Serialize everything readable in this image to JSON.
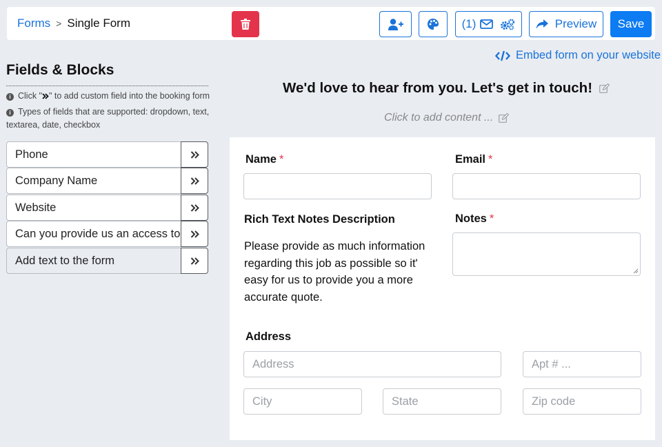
{
  "breadcrumb": {
    "link": "Forms",
    "separator": ">",
    "current": "Single Form"
  },
  "toolbar": {
    "email_count": "(1)",
    "preview_label": "Preview",
    "save_label": "Save"
  },
  "embed_link": "Embed form on your website",
  "sidebar": {
    "title": "Fields & Blocks",
    "hint1_pre": "Click \"",
    "hint1_post": "\" to add custom field into the booking form",
    "hint2_line1": "Types of fields that are supported: dropdown, text,",
    "hint2_line2": "textarea, date, checkbox",
    "fields": [
      {
        "label": "Phone"
      },
      {
        "label": "Company Name"
      },
      {
        "label": "Website"
      },
      {
        "label": "Can you provide us an access to t"
      },
      {
        "label": "Add text to the form"
      }
    ]
  },
  "form": {
    "heading": "We'd love to hear from you. Let's get in touch!",
    "click_to_add": "Click to add content ...",
    "name_label": "Name",
    "email_label": "Email",
    "required_mark": "*",
    "rich_text_title": "Rich Text Notes Description",
    "rich_text_body": "Please provide as much information regarding this job as possible so it' easy for us to provide you a more accurate quote.",
    "notes_label": "Notes",
    "address_label": "Address",
    "placeholders": {
      "address": "Address",
      "apt": "Apt # ...",
      "city": "City",
      "state": "State",
      "zip": "Zip code"
    }
  },
  "colors": {
    "accent": "#1a73d9",
    "save": "#0d7bf2",
    "danger": "#e4344c",
    "background": "#e9ecf1"
  }
}
